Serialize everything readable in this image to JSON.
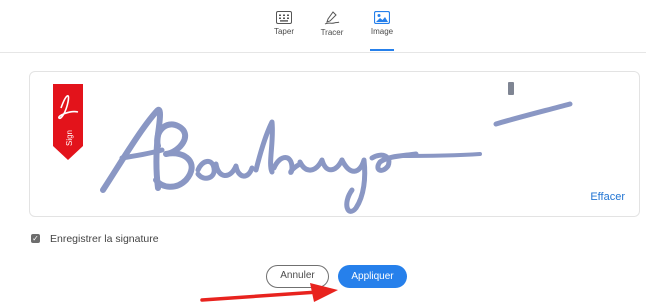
{
  "tabs": [
    {
      "label": "Taper",
      "icon": "keyboard-icon",
      "active": false
    },
    {
      "label": "Tracer",
      "icon": "pen-draw-icon",
      "active": false
    },
    {
      "label": "Image",
      "icon": "image-icon",
      "active": true
    }
  ],
  "signature": {
    "badge_text": "Sign",
    "clear_label": "Effacer",
    "colors": {
      "badge": "#e3131b",
      "ink": "#8a97c4"
    }
  },
  "save_option": {
    "label": "Enregistrer la signature",
    "checked": true
  },
  "buttons": {
    "cancel": "Annuler",
    "apply": "Appliquer"
  },
  "colors": {
    "accent": "#2680eb",
    "annotation_arrow": "#e8231e"
  }
}
